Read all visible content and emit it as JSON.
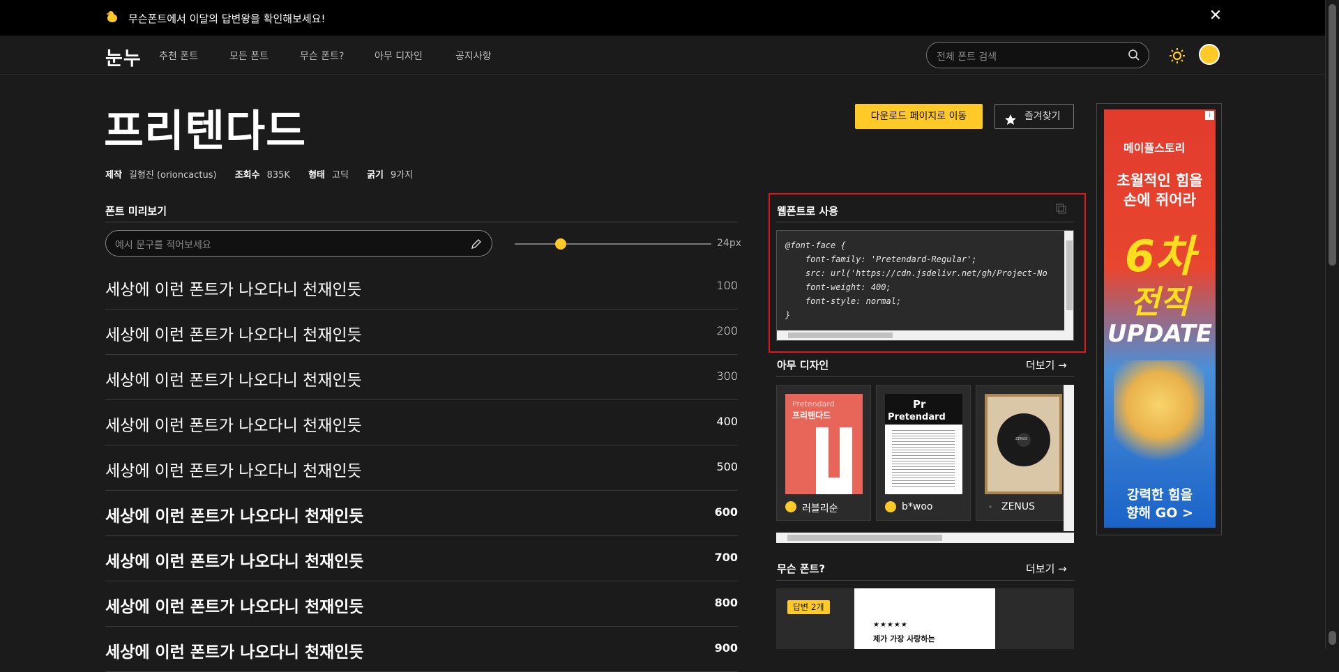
{
  "banner": {
    "text": "무슨폰트에서 이달의 답변왕을 확인해보세요!",
    "close": "✕"
  },
  "nav": {
    "logo": "눈누",
    "links": [
      "추천 폰트",
      "모든 폰트",
      "무슨 폰트?",
      "아무 디자인",
      "공지사항"
    ],
    "search_placeholder": "전체 폰트 검색"
  },
  "font": {
    "name": "프리텐다드",
    "maker_label": "제작",
    "maker": "길형진 (orioncactus)",
    "views_label": "조회수",
    "views": "835K",
    "type_label": "형태",
    "type": "고딕",
    "weight_label": "굵기",
    "weight": "9가지"
  },
  "actions": {
    "download": "다운로드 페이지로 이동",
    "favorite": "즐겨찾기"
  },
  "preview": {
    "heading": "폰트 미리보기",
    "placeholder": "예시 문구를 적어보세요",
    "size": "24px",
    "sample": "세상에 이런 폰트가 나오다니 천재인듯",
    "weights": [
      "100",
      "200",
      "300",
      "400",
      "500",
      "600",
      "700",
      "800",
      "900"
    ]
  },
  "webfont": {
    "heading": "웹폰트로 사용",
    "code": "@font-face {\n    font-family: 'Pretendard-Regular';\n    src: url('https://cdn.jsdelivr.net/gh/Project-No\n    font-weight: 400;\n    font-style: normal;\n}"
  },
  "design": {
    "heading": "아무 디자인",
    "more": "더보기 →",
    "cards": [
      {
        "name": "러블리순",
        "img_title": "프리텐다드",
        "img_sub": "Pretendard"
      },
      {
        "name": "b*woo",
        "img_title": "Pretendard",
        "img_sub": "Pr"
      },
      {
        "name": "ZENUS",
        "img_title": "ZENUS"
      }
    ]
  },
  "whatfont": {
    "heading": "무슨 폰트?",
    "more": "더보기 →",
    "badge": "답변 2개",
    "stars": "★★★★★",
    "question": "제가 가장 사랑하는"
  },
  "ad": {
    "brand": "메이플스토리",
    "line1": "초월적인 힘을",
    "line2": "손에 쥐어라",
    "big1": "6차",
    "big2": "전직",
    "big3": "UPDATE",
    "cta1": "강력한 힘을",
    "cta2": "향해 GO >"
  },
  "colors": {
    "accent": "#ffc928",
    "bg": "#1b1b1b",
    "highlight": "#e0161b"
  }
}
